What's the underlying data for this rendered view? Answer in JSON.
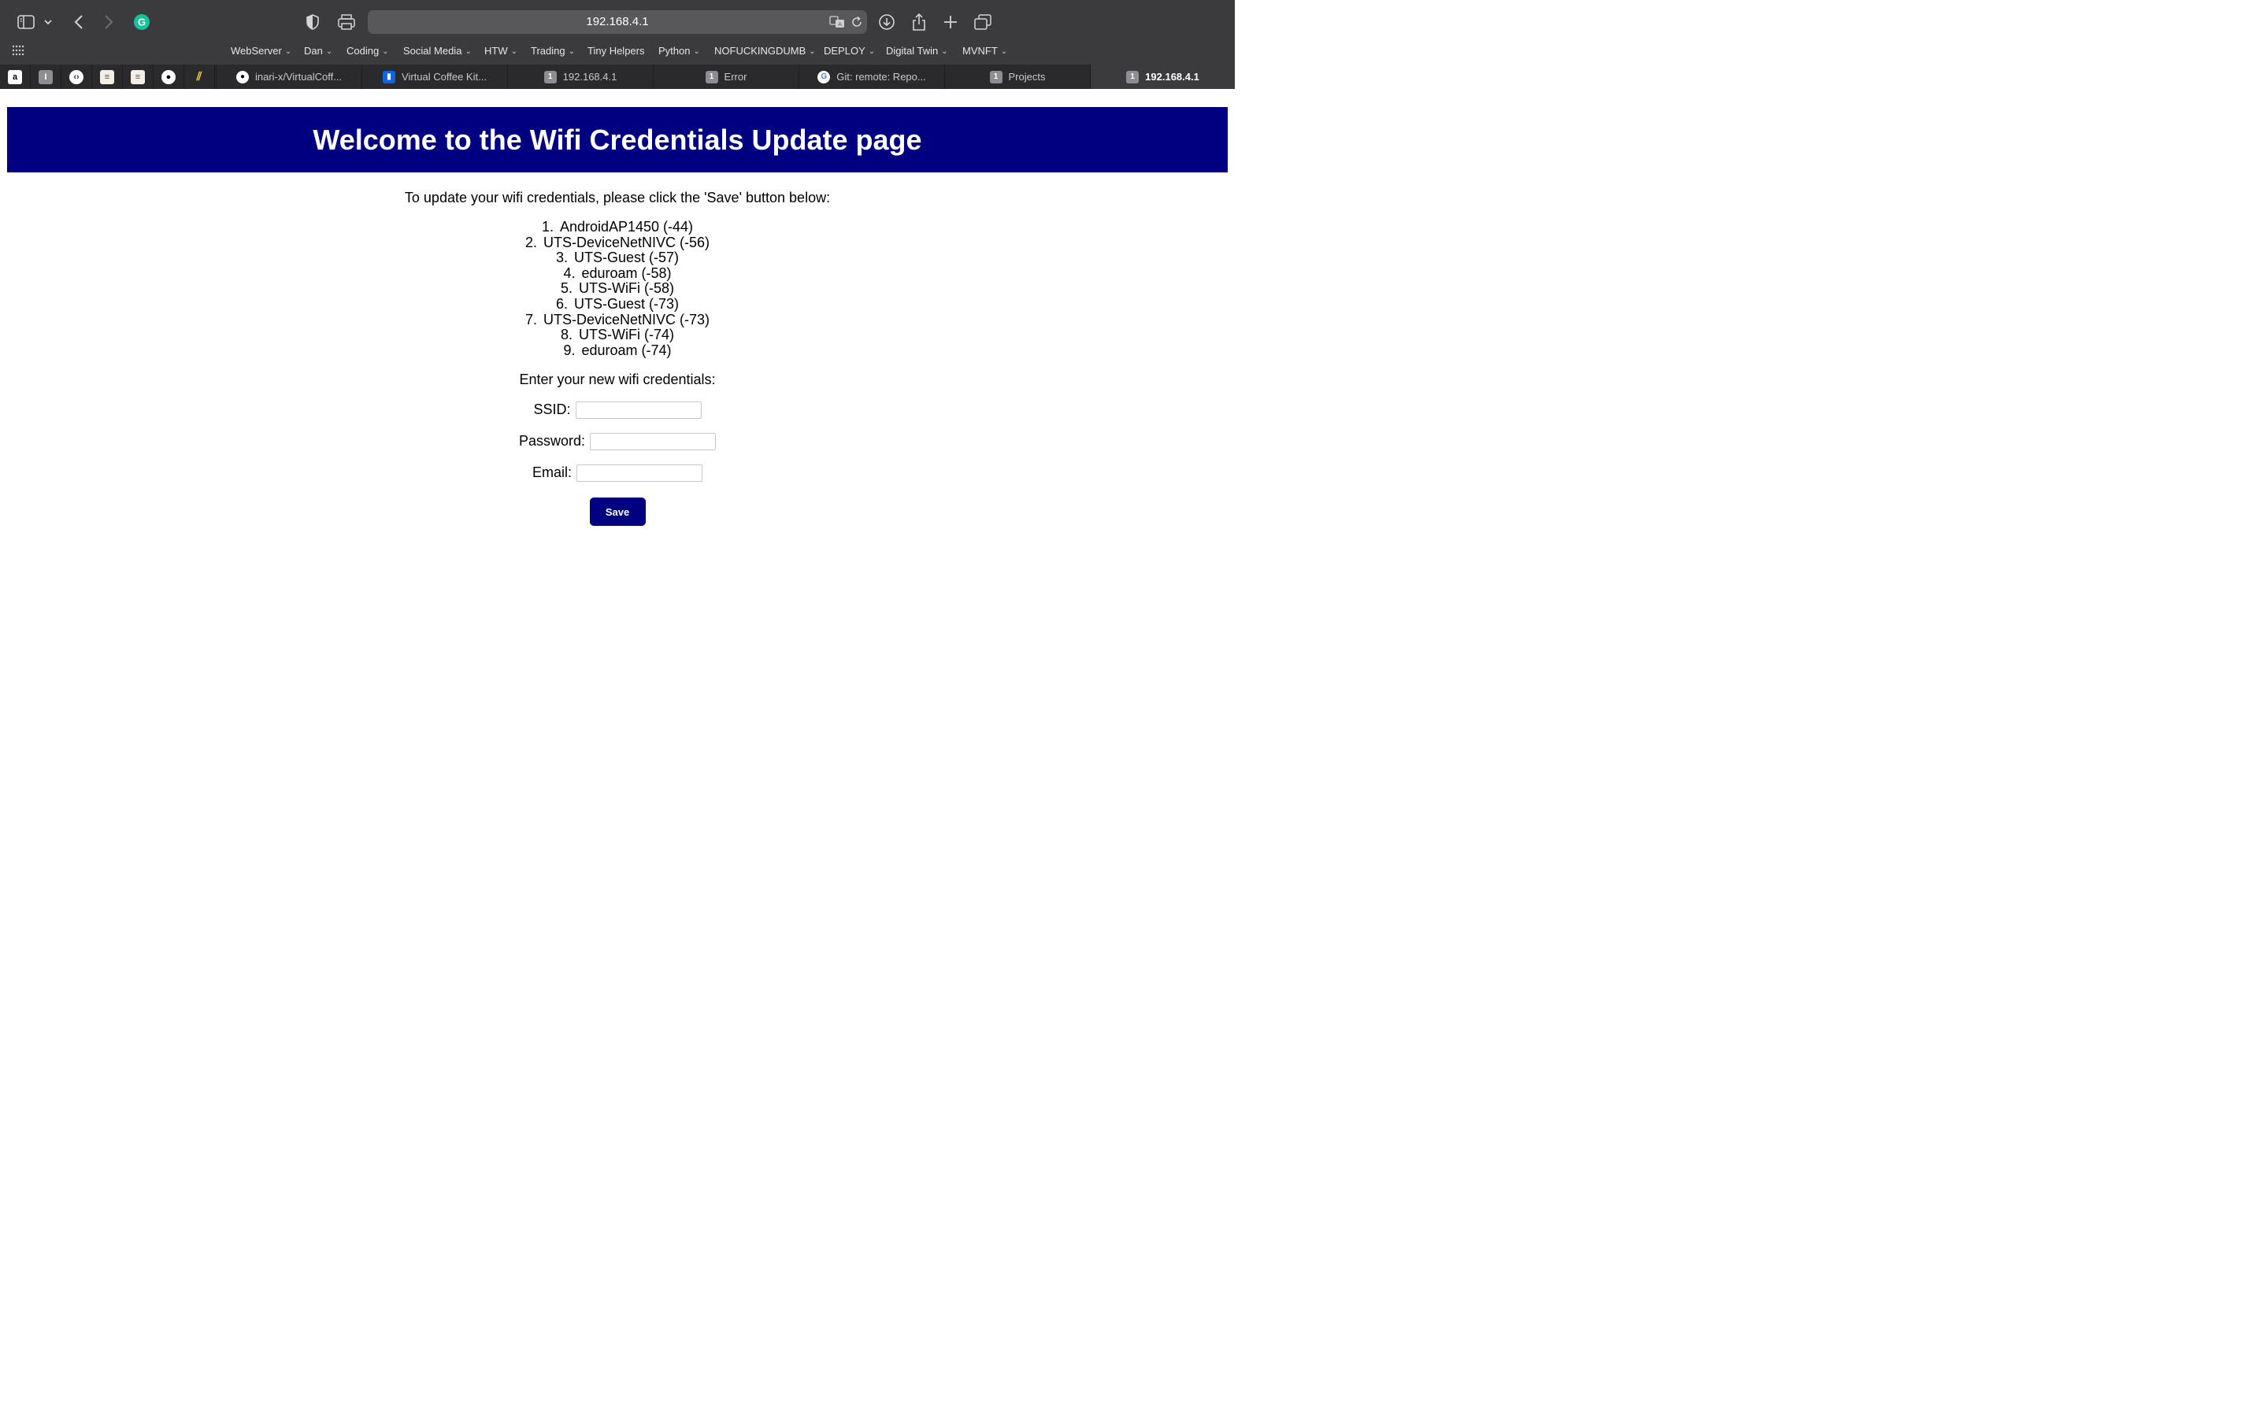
{
  "browser": {
    "url": "192.168.4.1",
    "bookmarks": [
      {
        "label": "WebServer",
        "folder": true
      },
      {
        "label": "Dan",
        "folder": true
      },
      {
        "label": "Coding",
        "folder": true
      },
      {
        "label": "Social Media",
        "folder": true
      },
      {
        "label": "HTW",
        "folder": true
      },
      {
        "label": "Trading",
        "folder": true
      },
      {
        "label": "Tiny Helpers",
        "folder": false
      },
      {
        "label": "Python",
        "folder": true
      },
      {
        "label": "NOFUCKINGDUMB",
        "folder": true
      },
      {
        "label": "DEPLOY",
        "folder": true
      },
      {
        "label": "Digital Twin",
        "folder": true
      },
      {
        "label": "MVNFT",
        "folder": true
      }
    ],
    "pinned_icons": [
      "amazon-icon",
      "letter-i-icon",
      "code-icon",
      "document-icon",
      "document-icon",
      "github-icon",
      "notes-icon"
    ],
    "tabs": [
      {
        "label": "inari-x/VirtualCoff...",
        "icon": "github-icon",
        "badge": ""
      },
      {
        "label": "Virtual Coffee Kit...",
        "icon": "trello-icon",
        "badge": ""
      },
      {
        "label": "192.168.4.1",
        "icon": "",
        "badge": "1"
      },
      {
        "label": "Error",
        "icon": "",
        "badge": "1"
      },
      {
        "label": "Git: remote: Repo...",
        "icon": "google-icon",
        "badge": ""
      },
      {
        "label": "Projects",
        "icon": "",
        "badge": "1"
      },
      {
        "label": "192.168.4.1",
        "icon": "",
        "badge": "1",
        "active": true
      }
    ]
  },
  "page": {
    "title": "Welcome to the Wifi Credentials Update page",
    "intro": "To update your wifi credentials, please click the 'Save' button below:",
    "networks": [
      {
        "num": "1.",
        "name": "AndroidAP1450 (-44)"
      },
      {
        "num": "2.",
        "name": "UTS-DeviceNetNIVC (-56)"
      },
      {
        "num": "3.",
        "name": "UTS-Guest (-57)"
      },
      {
        "num": "4.",
        "name": "eduroam (-58)"
      },
      {
        "num": "5.",
        "name": "UTS-WiFi (-58)"
      },
      {
        "num": "6.",
        "name": "UTS-Guest (-73)"
      },
      {
        "num": "7.",
        "name": "UTS-DeviceNetNIVC (-73)"
      },
      {
        "num": "8.",
        "name": "UTS-WiFi (-74)"
      },
      {
        "num": "9.",
        "name": "eduroam (-74)"
      }
    ],
    "prompt": "Enter your new wifi credentials:",
    "ssid_label": "SSID:",
    "ssid_value": "",
    "password_label": "Password:",
    "password_value": "",
    "email_label": "Email:",
    "email_value": "",
    "save_label": "Save"
  },
  "colors": {
    "banner": "#000080",
    "button": "#000080",
    "chrome": "#3b3b3d"
  }
}
